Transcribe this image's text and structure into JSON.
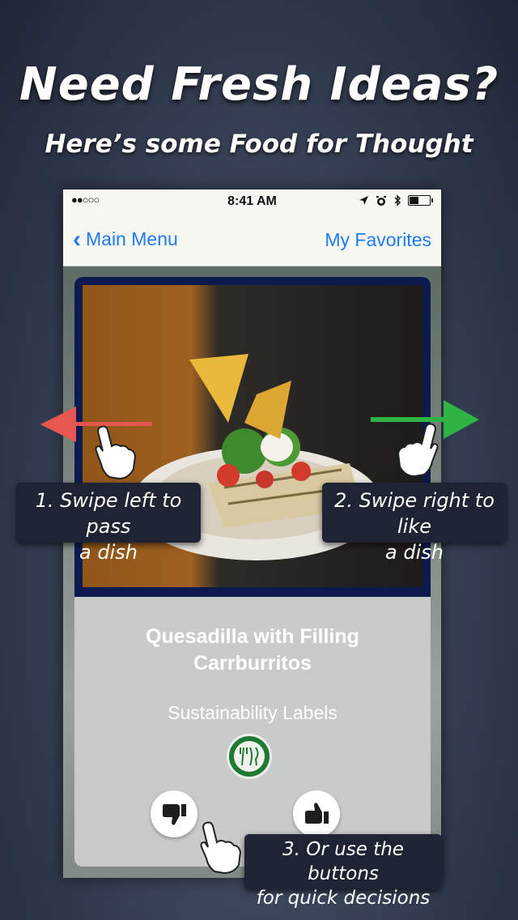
{
  "promo": {
    "headline": "Need Fresh Ideas?",
    "subheadline": "Here’s some Food for Thought"
  },
  "status_bar": {
    "signal": "●●○○○",
    "time": "8:41 AM",
    "icons": [
      "location-icon",
      "alarm-icon",
      "bluetooth-icon",
      "battery-icon"
    ]
  },
  "nav": {
    "back_label": "Main Menu",
    "favorites_label": "My Favorites"
  },
  "card": {
    "dish_name_line1": "Quesadilla with Filling",
    "dish_name_line2": "Carrburritos",
    "labels_heading": "Sustainability Labels",
    "badge_icon": "fork-knife-leaf-icon"
  },
  "callouts": {
    "swipe_left_line1": "1. Swipe left to pass",
    "swipe_left_line2": "a dish",
    "swipe_right_line1": "2. Swipe right to like",
    "swipe_right_line2": "a dish",
    "buttons_line1": "3. Or use the buttons",
    "buttons_line2": "for quick decisions"
  },
  "colors": {
    "accent_blue": "#1f7cf0",
    "left_arrow": "#e8574f",
    "right_arrow": "#2fb344",
    "badge_green": "#1f7a33",
    "callout_bg": "#1e2433",
    "card_frame": "#0d1a4e"
  }
}
